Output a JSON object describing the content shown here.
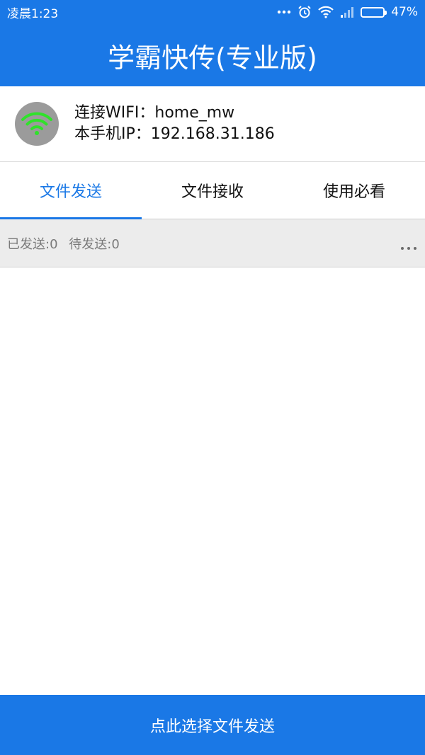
{
  "status_bar": {
    "time": "凌晨1:23",
    "battery_percent": "47%",
    "battery_level": 0.47,
    "icons": [
      "more-dots-icon",
      "alarm-icon",
      "wifi-icon",
      "signal-icon",
      "battery-icon"
    ]
  },
  "header": {
    "title": "学霸快传(专业版)"
  },
  "wifi_info": {
    "icon": "wifi-icon",
    "connected_line": "连接WIFI：home_mw",
    "ip_line": "本手机IP：192.168.31.186"
  },
  "tabs": [
    {
      "label": "文件发送",
      "active": true
    },
    {
      "label": "文件接收",
      "active": false
    },
    {
      "label": "使用必看",
      "active": false
    }
  ],
  "counters": {
    "sent": "已发送:0",
    "pending": "待发送:0",
    "more_icon": "more-horizontal-icon"
  },
  "bottom_button": {
    "label": "点此选择文件发送"
  },
  "colors": {
    "primary": "#1a78e6",
    "wifi_green": "#2fe22a",
    "avatar_gray": "#9b9b9b",
    "counter_bg": "#ececec"
  }
}
